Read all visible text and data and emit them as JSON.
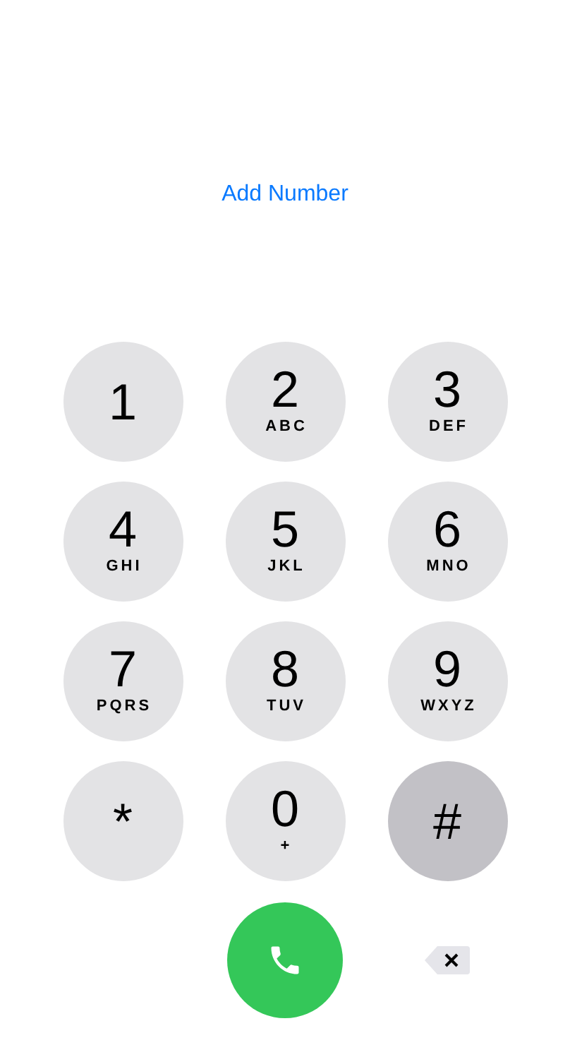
{
  "add_number": "Add Number",
  "keys": [
    {
      "digit": "1",
      "pressed": false
    },
    {
      "digit": "2",
      "letters": "ABC",
      "pressed": false
    },
    {
      "digit": "3",
      "letters": "DEF",
      "pressed": false
    },
    {
      "digit": "4",
      "letters": "GHI",
      "pressed": false
    },
    {
      "digit": "5",
      "letters": "JKL",
      "pressed": false
    },
    {
      "digit": "6",
      "letters": "MNO",
      "pressed": false
    },
    {
      "digit": "7",
      "letters": "PQRS",
      "pressed": false
    },
    {
      "digit": "8",
      "letters": "TUV",
      "pressed": false
    },
    {
      "digit": "9",
      "letters": "WXYZ",
      "pressed": false
    },
    {
      "digit": "*",
      "pressed": false
    },
    {
      "digit": "0",
      "letters": "+",
      "pressed": false
    },
    {
      "digit": "#",
      "pressed": true
    }
  ]
}
